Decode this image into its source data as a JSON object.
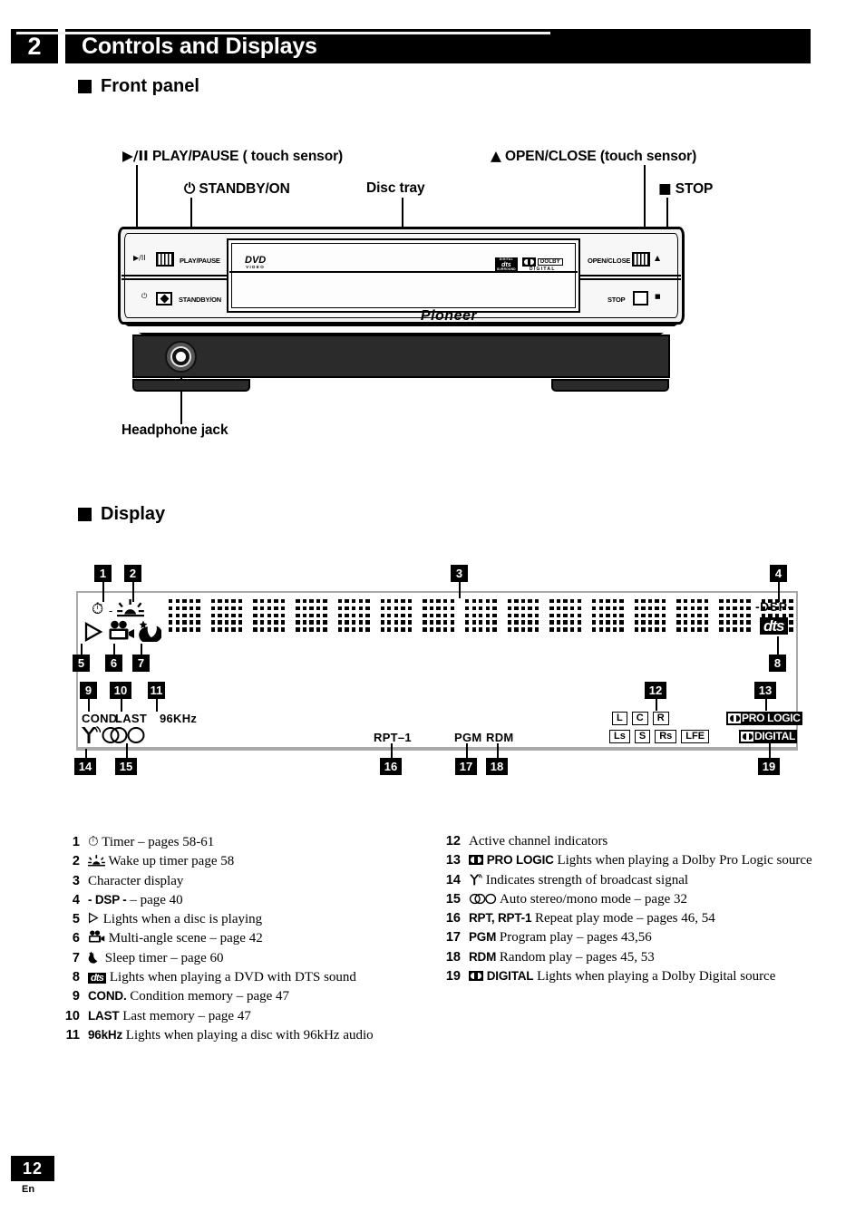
{
  "chapter": {
    "number": "2",
    "title": "Controls and Displays"
  },
  "sections": {
    "front_panel": "Front panel",
    "display": "Display"
  },
  "front_panel_callouts": {
    "play_pause": "PLAY/PAUSE ( touch sensor)",
    "play_pause_glyph": "▶/II",
    "open_close": "OPEN/CLOSE (touch sensor)",
    "open_close_glyph": "▲",
    "standby_on": "STANDBY/ON",
    "standby_glyph": "⏻",
    "disc_tray": "Disc tray",
    "stop": "STOP",
    "stop_glyph": "■",
    "headphone_jack": "Headphone jack"
  },
  "device": {
    "panel_play_pause": "PLAY/PAUSE",
    "panel_play_glyph": "▶/II",
    "panel_standby": "STANDBY/ON",
    "panel_standby_glyph": "⏻",
    "panel_open_close": "OPEN/CLOSE",
    "panel_eject_glyph": "▲",
    "panel_stop": "STOP",
    "panel_stop_glyph": "■",
    "brand": "Pioneer",
    "dvd_logo": "DVD",
    "dvd_logo_sub": "VIDEO",
    "dts_logo_top": "DIGITAL",
    "dts_logo": "dts",
    "dts_logo_bottom": "SURROUND",
    "dolby_word": "DOLBY",
    "dolby_sub": "DIGITAL"
  },
  "display_diagram": {
    "numbers": [
      "1",
      "2",
      "3",
      "4",
      "5",
      "6",
      "7",
      "8",
      "9",
      "10",
      "11",
      "12",
      "13",
      "14",
      "15",
      "16",
      "17",
      "18",
      "19"
    ],
    "dsp": "-DSP-",
    "dts": "dts",
    "cond": "COND.",
    "last": "LAST",
    "khz": "96KHz",
    "rpt": "RPT–1",
    "pgm": "PGM",
    "rdm": "RDM",
    "channels_top": [
      "L",
      "C",
      "R"
    ],
    "channels_bottom": [
      "Ls",
      "S",
      "Rs",
      "LFE"
    ],
    "pro_logic": "PRO LOGIC",
    "digital": "DIGITAL",
    "character_cells": 15
  },
  "legend_left": [
    {
      "num": "1",
      "icon": "clock-icon",
      "text": "Timer – pages 58-61"
    },
    {
      "num": "2",
      "icon": "sunrise-icon",
      "text": "Wake up timer  page 58"
    },
    {
      "num": "3",
      "icon": "",
      "text": "Character display"
    },
    {
      "num": "4",
      "icon": "dsp-label",
      "bold": "- DSP -",
      "text": " – page 40"
    },
    {
      "num": "5",
      "icon": "play-triangle-icon",
      "text": "Lights when a disc is playing"
    },
    {
      "num": "6",
      "icon": "camera-icon",
      "text": "Multi-angle scene – page 42"
    },
    {
      "num": "7",
      "icon": "moon-star-icon",
      "text": "Sleep timer – page 60"
    },
    {
      "num": "8",
      "icon": "dts-icon",
      "text": "Lights when playing a DVD with DTS sound"
    },
    {
      "num": "9",
      "icon": "",
      "bold": "COND.",
      "text": " Condition memory – page 47"
    },
    {
      "num": "10",
      "icon": "",
      "bold": "LAST",
      "text": " Last memory – page 47"
    },
    {
      "num": "11",
      "icon": "",
      "bold": "96kHz",
      "text": " Lights when playing a disc with 96kHz audio"
    }
  ],
  "legend_right": [
    {
      "num": "12",
      "icon": "",
      "text": "Active channel indicators"
    },
    {
      "num": "13",
      "icon": "dolby-icon",
      "bold": "PRO LOGIC",
      "text": " Lights when playing a Dolby Pro Logic source"
    },
    {
      "num": "14",
      "icon": "antenna-icon",
      "text": "Indicates strength of broadcast signal"
    },
    {
      "num": "15",
      "icon": "stereo-mono-icon",
      "text": "Auto stereo/mono mode – page 32"
    },
    {
      "num": "16",
      "icon": "",
      "bold": "RPT, RPT-1",
      "text": "  Repeat play mode – pages 46, 54"
    },
    {
      "num": "17",
      "icon": "",
      "bold": "PGM",
      "text": " Program play – pages 43,56"
    },
    {
      "num": "18",
      "icon": "",
      "bold": "RDM",
      "text": " Random play – pages 45, 53"
    },
    {
      "num": "19",
      "icon": "dolby-icon",
      "bold": "DIGITAL",
      "text": " Lights when playing a Dolby Digital source"
    }
  ],
  "footer": {
    "page": "12",
    "lang": "En"
  }
}
